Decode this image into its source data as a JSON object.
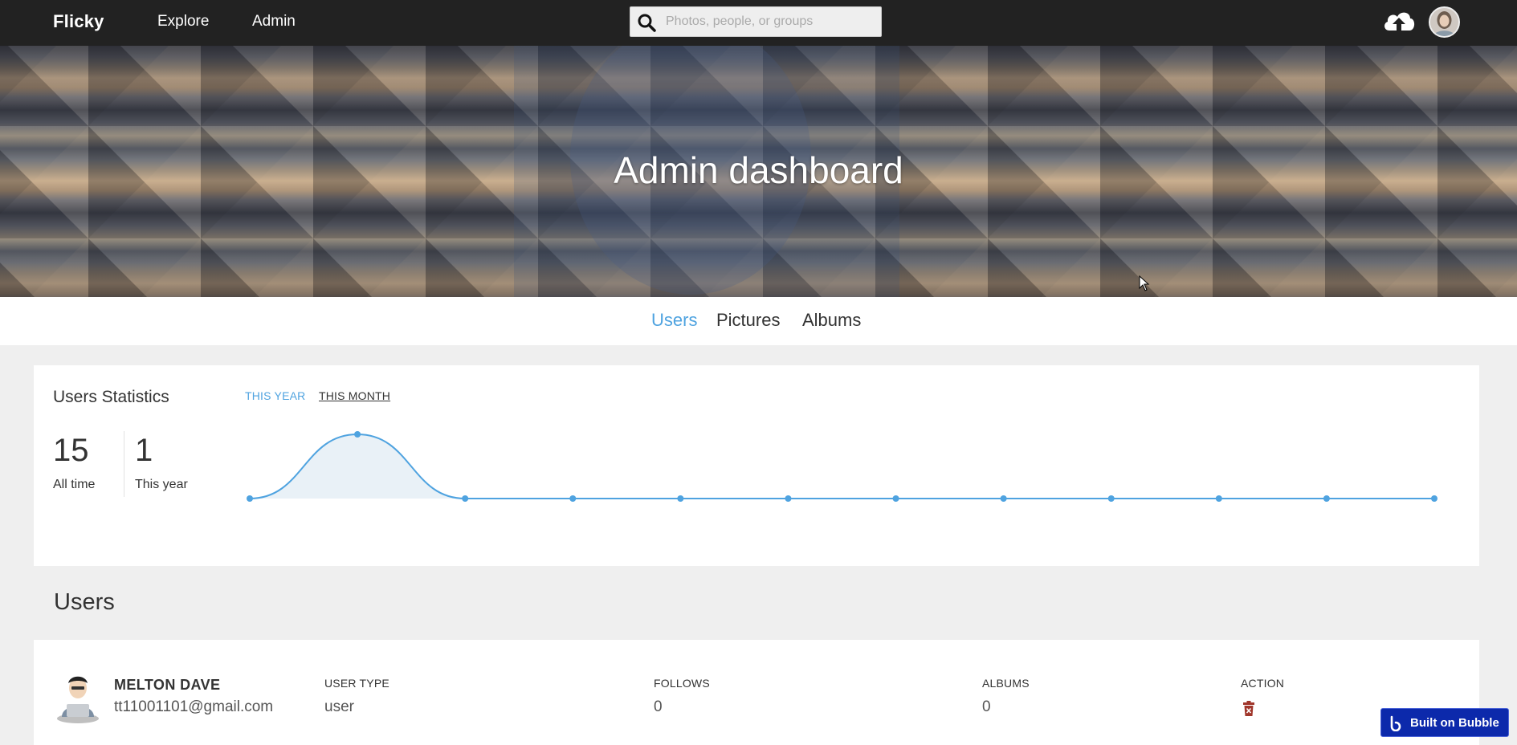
{
  "nav": {
    "brand": "Flicky",
    "links": [
      {
        "label": "Explore"
      },
      {
        "label": "Admin"
      }
    ],
    "search_placeholder": "Photos, people, or groups",
    "search_value": ""
  },
  "hero": {
    "title": "Admin dashboard"
  },
  "tabs": [
    {
      "label": "Users",
      "active": true
    },
    {
      "label": "Pictures",
      "active": false
    },
    {
      "label": "Albums",
      "active": false
    }
  ],
  "stats": {
    "title": "Users Statistics",
    "periods": [
      {
        "label": "THIS YEAR",
        "active": true
      },
      {
        "label": "THIS MONTH",
        "active": false
      }
    ],
    "all_time": {
      "value": "15",
      "label": "All time"
    },
    "this_year": {
      "value": "1",
      "label": "This year"
    }
  },
  "chart_data": {
    "type": "area",
    "x": [
      1,
      2,
      3,
      4,
      5,
      6,
      7,
      8,
      9,
      10,
      11,
      12
    ],
    "series": [
      {
        "values": [
          0,
          1,
          0,
          0,
          0,
          0,
          0,
          0,
          0,
          0,
          0,
          0
        ]
      }
    ],
    "ylim": [
      0,
      1
    ],
    "grid": false,
    "color": "#4fa3e0",
    "fill": "#e9f1f7"
  },
  "users_section": {
    "heading": "Users",
    "columns": [
      "USER TYPE",
      "FOLLOWS",
      "ALBUMS",
      "ACTION"
    ],
    "rows": [
      {
        "name": "MELTON DAVE",
        "email": "tt11001101@gmail.com",
        "user_type": "user",
        "follows": "0",
        "albums": "0",
        "action_icon": "trash-icon"
      }
    ]
  },
  "badge": {
    "label": "Built on Bubble"
  },
  "colors": {
    "accent": "#4fa3e0",
    "navbar": "#222222",
    "badge": "#0c29ab",
    "delete": "#a0362b"
  }
}
